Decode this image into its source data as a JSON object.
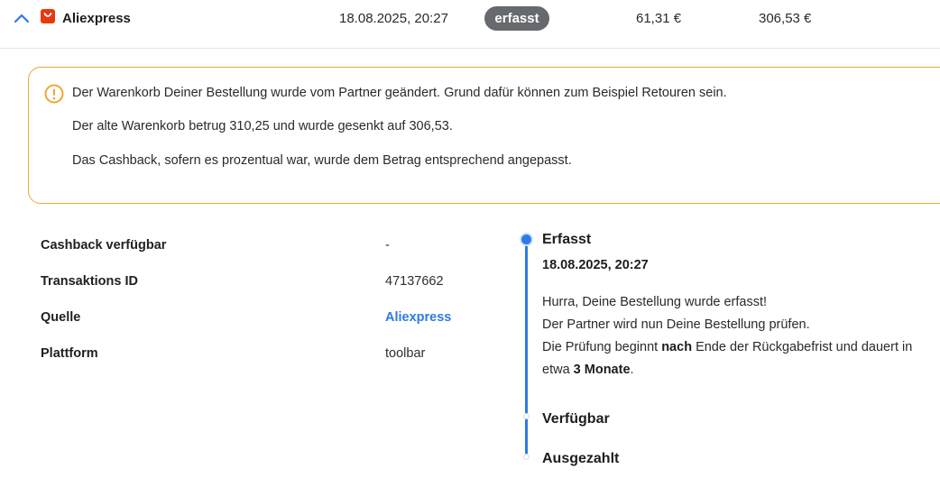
{
  "transaction": {
    "shop_name": "Aliexpress",
    "shop_icon": "aliexpress-bag-icon",
    "date": "18.08.2025, 20:27",
    "status_badge": "erfasst",
    "cashback_amount": "61,31 €",
    "order_amount": "306,53 €"
  },
  "notice": {
    "icon": "warning-circle-icon",
    "accent_color": "#F0A733",
    "line1": "Der Warenkorb Deiner Bestellung wurde vom Partner geändert. Grund dafür können zum Beispiel Retouren sein.",
    "line2": "Der alte Warenkorb betrug 310,25 und wurde gesenkt auf 306,53.",
    "line3": "Das Cashback, sofern es prozentual war, wurde dem Betrag entsprechend angepasst."
  },
  "details": [
    {
      "label": "Cashback verfügbar",
      "value": "-"
    },
    {
      "label": "Transaktions ID",
      "value": "47137662"
    },
    {
      "label": "Quelle",
      "value": "Aliexpress"
    },
    {
      "label": "Plattform",
      "value": "toolbar"
    }
  ],
  "timeline": {
    "accent_color": "#2D7BE5",
    "steps": [
      {
        "title": "Erfasst",
        "date": "18.08.2025, 20:27",
        "desc_line1": "Hurra, Deine Bestellung wurde erfasst!",
        "desc_line2": "Der Partner wird nun Deine Bestellung prüfen.",
        "desc_line3_pre": "Die Prüfung beginnt ",
        "desc_line3_bold": "nach",
        "desc_line3_post": " Ende der Rückgabefrist und dauert in etwa ",
        "desc_line3_bold2": "3 Monate",
        "desc_line3_end": "."
      },
      {
        "title": "Verfügbar"
      },
      {
        "title": "Ausgezahlt"
      }
    ]
  }
}
